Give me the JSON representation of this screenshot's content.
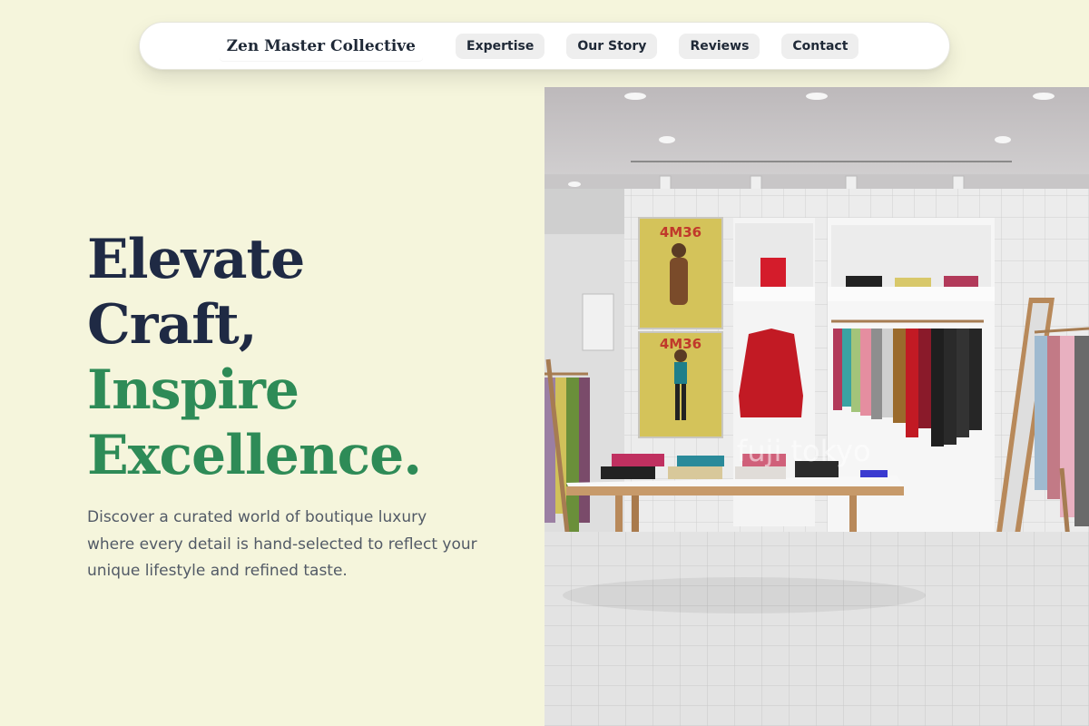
{
  "nav": {
    "brand": "Zen Master Collective",
    "links": [
      "Expertise",
      "Our Story",
      "Reviews",
      "Contact"
    ]
  },
  "hero": {
    "headline_dark": [
      "Elevate",
      "Craft,"
    ],
    "headline_green": [
      "Inspire",
      "Excellence."
    ],
    "description": "Discover a curated world of boutique luxury where every detail is hand-selected to reflect your unique lifestyle and refined taste."
  },
  "photo": {
    "poster_text": "4M36",
    "window_text": "fuji tokyo"
  },
  "colors": {
    "background": "#f5f5dc",
    "headline_dark": "#1f2a44",
    "accent_green": "#2e8b57",
    "body_text": "#525a66"
  }
}
